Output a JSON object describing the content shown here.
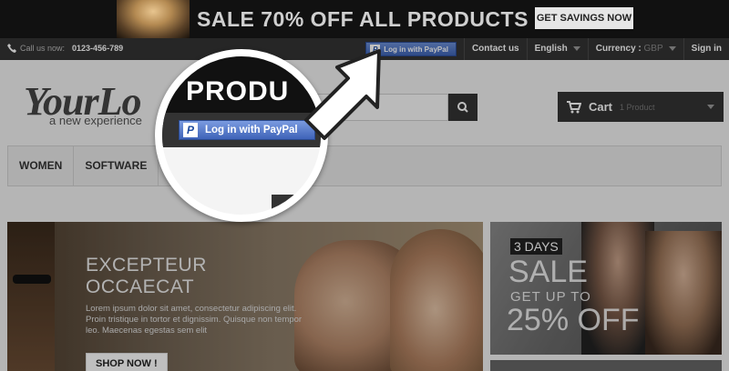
{
  "promo": {
    "text": "SALE 70% OFF ALL PRODUCTS",
    "button": "GET SAVINGS NOW"
  },
  "topnav": {
    "call_label": "Call us now:",
    "phone": "0123-456-789",
    "paypal_button": "Log in with PayPal",
    "contact": "Contact us",
    "language": "English",
    "currency_label": "Currency :",
    "currency_value": "GBP",
    "signin": "Sign in"
  },
  "header": {
    "logo_text": "YourLo",
    "logo_sub": "a new experience",
    "cart_label": "Cart",
    "cart_count": "1 Product"
  },
  "menu": {
    "items": [
      "WOMEN",
      "SOFTWARE"
    ]
  },
  "hero": {
    "title": "EXCEPTEUR OCCAECAT",
    "description": "Lorem ipsum dolor sit amet, consectetur adipiscing elit. Proin tristique in tortor et dignissim. Quisque non tempor leo. Maecenas egestas sem elit",
    "button": "SHOP NOW !"
  },
  "side_banner": {
    "days": "3 DAYS",
    "big": "SALE",
    "sub": "GET UP TO",
    "percent": "25% OFF"
  },
  "magnifier": {
    "word": "PRODU",
    "paypal_button": "Log in with PayPal"
  }
}
